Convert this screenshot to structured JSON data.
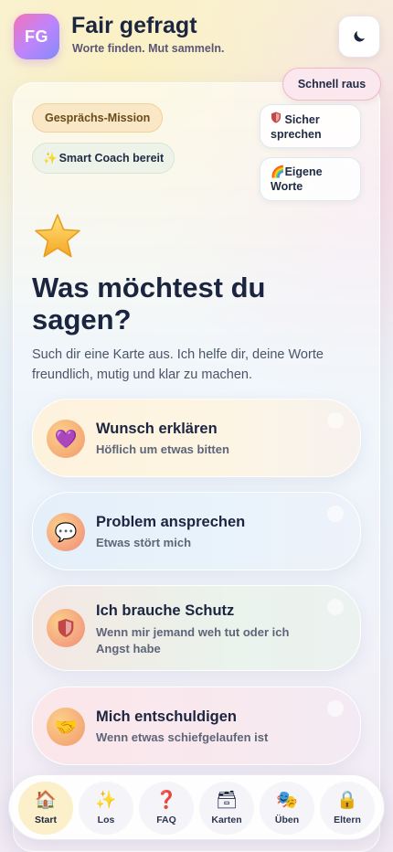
{
  "header": {
    "logo_text": "FG",
    "title": "Fair gefragt",
    "subtitle": "Worte finden. Mut sammeln.",
    "theme_icon": "moon-icon"
  },
  "quick_exit_label": "Schnell raus",
  "badges": {
    "mission": "Gesprächs-Mission",
    "coach": "Smart Coach bereit"
  },
  "side_buttons": {
    "safe_line1": "Sicher",
    "safe_line2": "sprechen",
    "own_line1": "Eigene",
    "own_line2": "Worte"
  },
  "headline": "Was möchtest du sagen?",
  "lead": "Such dir eine Karte aus. Ich helfe dir, deine Worte freundlich, mutig und klar zu machen.",
  "options": [
    {
      "title": "Wunsch erklären",
      "subtitle": "Höflich um etwas bitten",
      "icon": "purple-heart-icon"
    },
    {
      "title": "Problem ansprechen",
      "subtitle": "Etwas stört mich",
      "icon": "speech-bubble-icon"
    },
    {
      "title": "Ich brauche Schutz",
      "subtitle": "Wenn mir jemand weh tut oder ich Angst habe",
      "icon": "shield-icon"
    },
    {
      "title": "Mich entschuldigen",
      "subtitle": "Wenn etwas schiefgelaufen ist",
      "icon": "handshake-icon"
    }
  ],
  "nav": [
    {
      "label": "Start",
      "icon": "house-icon",
      "active": true
    },
    {
      "label": "Los",
      "icon": "sparkles-icon",
      "active": false
    },
    {
      "label": "FAQ",
      "icon": "question-mark-icon",
      "active": false
    },
    {
      "label": "Karten",
      "icon": "card-box-icon",
      "active": false
    },
    {
      "label": "Üben",
      "icon": "theater-masks-icon",
      "active": false
    },
    {
      "label": "Eltern",
      "icon": "lock-icon",
      "active": false
    }
  ]
}
